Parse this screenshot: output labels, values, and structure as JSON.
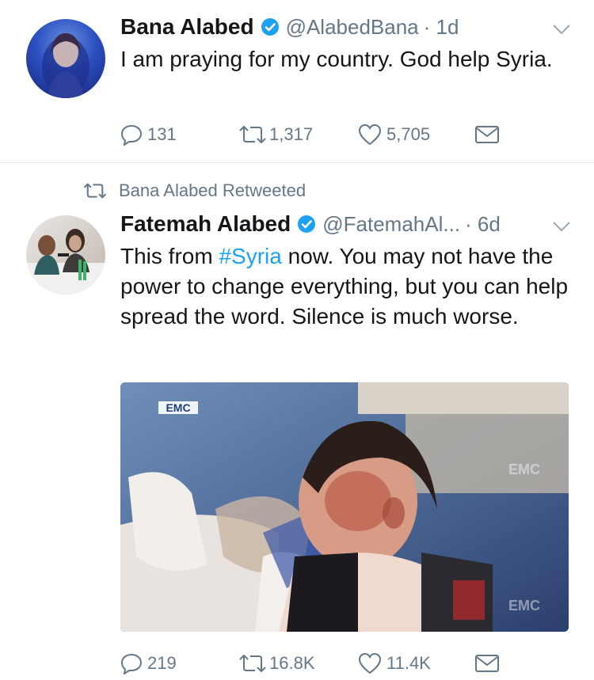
{
  "tweet1": {
    "name": "Bana Alabed",
    "handle": "@AlabedBana",
    "time": "· 1d",
    "text": "I am praying for my country. God help Syria.",
    "replies": "131",
    "retweets": "1,317",
    "likes": "5,705"
  },
  "retweet_label": "Bana Alabed Retweeted",
  "tweet2": {
    "name": "Fatemah Alabed",
    "handle": "@FatemahAl...",
    "time": "· 6d",
    "text_before": "This from ",
    "hashtag": "#Syria",
    "text_after": " now. You may not have the power to change everything, but you can help spread the word. Silence is much worse.",
    "media_watermark": "EMC",
    "replies": "219",
    "retweets": "16.8K",
    "likes": "11.4K"
  },
  "colors": {
    "text": "#14171a",
    "secondary": "#657786",
    "link": "#1da1f2",
    "divider": "#e1e8ed"
  }
}
